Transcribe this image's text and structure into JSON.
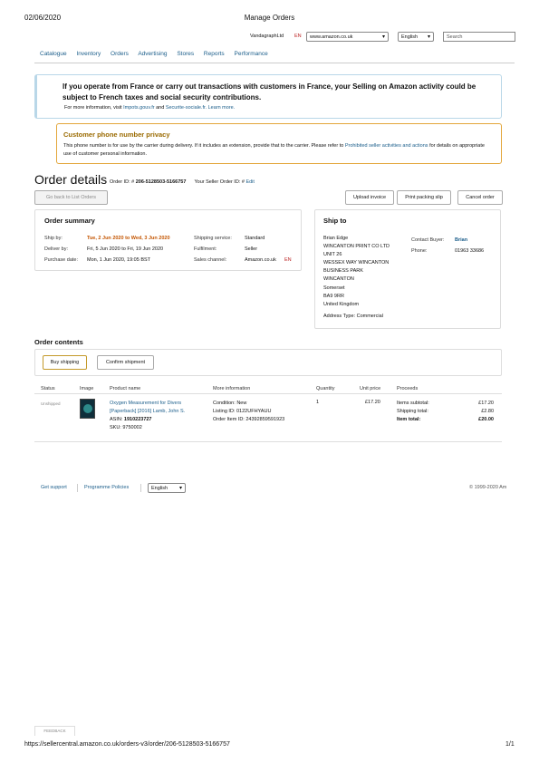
{
  "print_header": {
    "date": "02/06/2020",
    "title": "Manage Orders"
  },
  "topbar": {
    "merchant": "VandagraphLtd",
    "marketplace_flag": "EN",
    "marketplace": "www.amazon.co.uk",
    "language": "English",
    "search_placeholder": "Search"
  },
  "nav": {
    "items": [
      "Catalogue",
      "Inventory",
      "Orders",
      "Advertising",
      "Stores",
      "Reports",
      "Performance"
    ]
  },
  "alerts": {
    "tax_heading": "If you operate from France or carry out transactions with customers in France, your Selling on Amazon activity could be subject to French taxes and social security contributions.",
    "tax_sub_prefix": "For more information, visit",
    "tax_link1": "Impots.gouv.fr",
    "tax_and": "and",
    "tax_link2": "Securite-sociale.fr. Learn more.",
    "phone_heading": "Customer phone number privacy",
    "phone_text1": "This phone number is for use by the carrier during delivery. If it includes an extension, provide that to the carrier. Please refer to",
    "phone_link": "Prohibited seller activities and actions",
    "phone_text2": "for details on appropriate use of customer personal information."
  },
  "order": {
    "title": "Order details",
    "order_id_label": "Order ID: #",
    "order_id": "206-5128503-5166757",
    "seller_order_label": "Your Seller Order ID: #",
    "edit": "Edit",
    "back_button": "Go back to List Orders",
    "upload_invoice": "Upload invoice",
    "print_packing_slip": "Print packing slip",
    "cancel_order": "Cancel order"
  },
  "summary": {
    "heading": "Order summary",
    "ship_by_label": "Ship by:",
    "ship_by": "Tue, 2 Jun 2020 to Wed, 3 Jun 2020",
    "deliver_by_label": "Deliver by:",
    "deliver_by": "Fri, 5 Jun 2020 to Fri, 19 Jun 2020",
    "purchase_date_label": "Purchase date:",
    "purchase_date": "Mon, 1 Jun 2020, 19:05 BST",
    "shipping_service_label": "Shipping service:",
    "shipping_service": "Standard",
    "fulfilment_label": "Fulfilment:",
    "fulfilment": "Seller",
    "sales_channel_label": "Sales channel:",
    "sales_channel": "Amazon.co.uk",
    "sales_channel_flag": "EN"
  },
  "ship_to": {
    "heading": "Ship to",
    "address_lines": [
      "Brian Edge",
      "WINCANTON PRINT CO LTD",
      "UNIT 26",
      "WESSEX WAY WINCANTON",
      "BUSINESS PARK",
      "WINCANTON",
      "Somerset",
      "BA9 9RR",
      "United Kingdom"
    ],
    "address_type_label": "Address Type:",
    "address_type": "Commercial",
    "contact_buyer_label": "Contact Buyer:",
    "contact_buyer": "Brian",
    "phone_label": "Phone:",
    "phone": "01963 33686"
  },
  "contents": {
    "heading": "Order contents",
    "buy_shipping": "Buy shipping",
    "confirm_shipment": "Confirm shipment",
    "columns": [
      "Status",
      "Image",
      "Product name",
      "More information",
      "Quantity",
      "Unit price",
      "Proceeds"
    ],
    "item": {
      "status": "Unshipped",
      "product_name_line1": "Oxygen Measurement for Divers",
      "product_name_line2": "[Paperback] [2016] Lamb, John S.",
      "asin_label": "ASIN:",
      "asin": "1910223727",
      "sku_label": "SKU:",
      "sku": "9750002",
      "condition_label": "Condition:",
      "condition": "New",
      "listing_id_label": "Listing ID:",
      "listing_id": "0122UFHYAUU",
      "order_item_id_label": "Order Item ID:",
      "order_item_id": "24392859591923",
      "quantity": "1",
      "unit_price": "£17.20",
      "items_subtotal_label": "Items subtotal:",
      "items_subtotal": "£17.20",
      "shipping_total_label": "Shipping total:",
      "shipping_total": "£2.80",
      "item_total_label": "Item total:",
      "item_total": "£20.00"
    }
  },
  "footer": {
    "get_support": "Get support",
    "programme_policies": "Programme Policies",
    "language": "English",
    "copyright": "© 1999-2020 Am"
  },
  "feedback": "FEEDBACK",
  "print_footer": {
    "url": "https://sellercentral.amazon.co.uk/orders-v3/order/206-5128503-5166757",
    "page": "1/1"
  },
  "colors": {
    "link": "#1a5d8a",
    "accent_orange": "#c45500",
    "warning_border": "#e3a63a",
    "info_border": "#b9d7e8"
  }
}
